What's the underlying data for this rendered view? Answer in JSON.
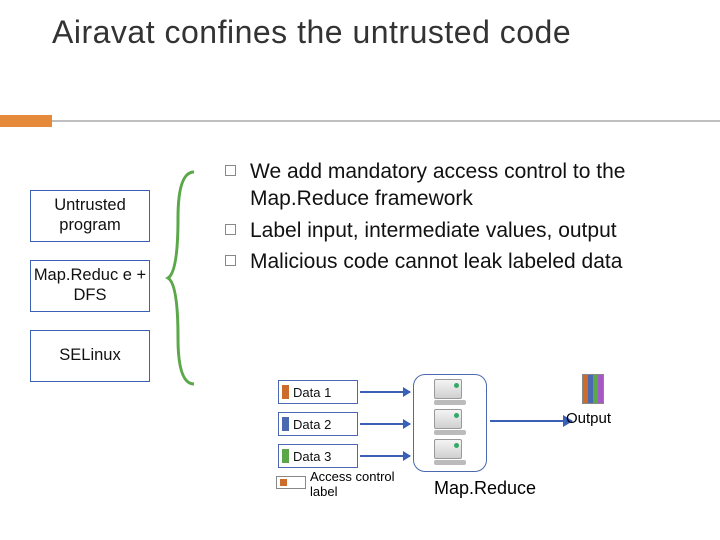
{
  "title": "Airavat confines the untrusted code",
  "left_boxes": {
    "b1": "Untrusted program",
    "b2": "Map.Reduc e + DFS",
    "b3": "SELinux"
  },
  "bullets": {
    "i0": "We add mandatory access control to the Map.Reduce framework",
    "i1": "Label input, intermediate values, output",
    "i2": "Malicious code cannot leak labeled data"
  },
  "diagram": {
    "data_items": {
      "d1": "Data 1",
      "d2": "Data 2",
      "d3": "Data 3"
    },
    "access_label": "Access control label",
    "mapreduce_label": "Map.Reduce",
    "output_label": "Output"
  },
  "colors": {
    "accent_orange": "#e58a3a",
    "box_border": "#3a61b5",
    "brace_green": "#5aa849"
  }
}
